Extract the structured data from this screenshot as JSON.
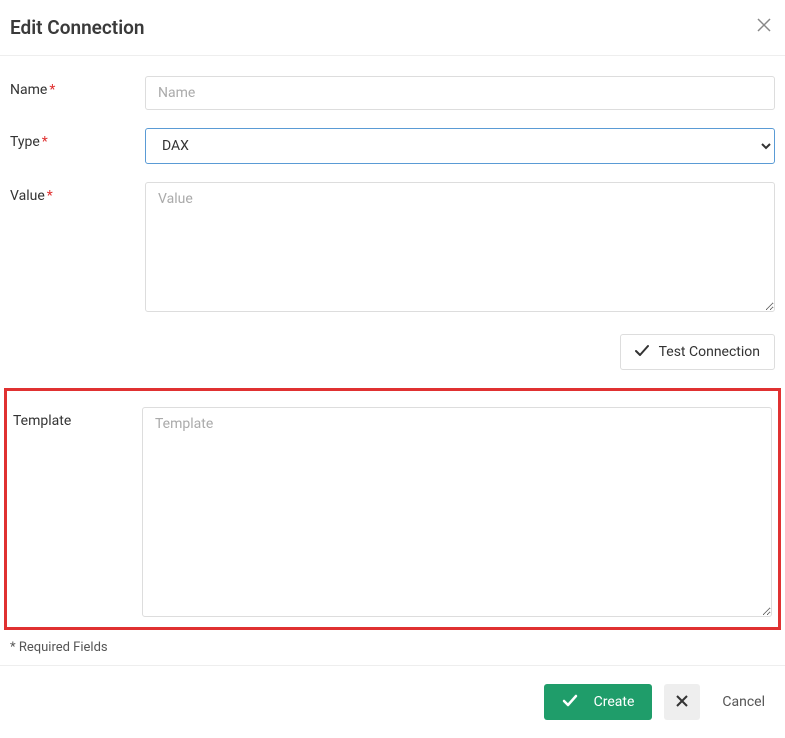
{
  "header": {
    "title": "Edit Connection"
  },
  "form": {
    "name": {
      "label": "Name",
      "placeholder": "Name",
      "value": ""
    },
    "type": {
      "label": "Type",
      "selected": "DAX"
    },
    "value": {
      "label": "Value",
      "placeholder": "Value",
      "value": ""
    },
    "template": {
      "label": "Template",
      "placeholder": "Template",
      "value": ""
    }
  },
  "actions": {
    "test_label": "Test Connection",
    "create_label": "Create",
    "cancel_label": "Cancel"
  },
  "notes": {
    "required_fields": "* Required Fields"
  }
}
